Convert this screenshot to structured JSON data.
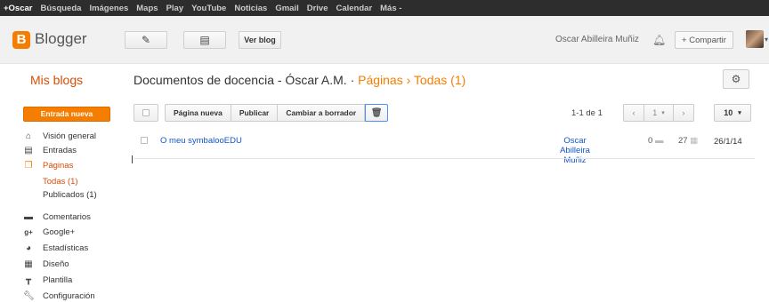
{
  "gbar": {
    "items": [
      "+Oscar",
      "Búsqueda",
      "Imágenes",
      "Maps",
      "Play",
      "YouTube",
      "Noticias",
      "Gmail",
      "Drive",
      "Calendar",
      "Más -"
    ]
  },
  "header": {
    "logo_letter": "B",
    "brand": "Blogger",
    "view_blog": "Ver blog",
    "user_name": "Oscar Abilleira Muñiz",
    "share": "+ Compartir",
    "icons": {
      "edit": "pencil-icon",
      "pages": "pages-icon",
      "notifications": "bell-icon"
    }
  },
  "title_row": {
    "my_blogs": "Mis blogs",
    "blog_title": "Documentos de docencia - Óscar A.M.",
    "separator": "·",
    "crumb_pages": "Páginas",
    "crumb_arrow": "›",
    "crumb_all": "Todas (1)"
  },
  "sidebar": {
    "new_entry": "Entrada nueva",
    "items": [
      {
        "label": "Visión general",
        "icon": "home-icon"
      },
      {
        "label": "Entradas",
        "icon": "posts-icon"
      },
      {
        "label": "Páginas",
        "icon": "pages-icon"
      },
      {
        "label": "Comentarios",
        "icon": "comment-icon"
      },
      {
        "label": "Google+",
        "icon": "google-plus-icon"
      },
      {
        "label": "Estadísticas",
        "icon": "pie-chart-icon"
      },
      {
        "label": "Diseño",
        "icon": "layout-icon"
      },
      {
        "label": "Plantilla",
        "icon": "template-icon"
      },
      {
        "label": "Configuración",
        "icon": "wrench-icon"
      }
    ],
    "sub_items": [
      "Todas (1)",
      "Publicados (1)"
    ]
  },
  "toolbar": {
    "new_page": "Página nueva",
    "publish": "Publicar",
    "to_draft": "Cambiar a borrador",
    "count": "1-1 de 1",
    "page_number": "1",
    "per_page": "10"
  },
  "rows": [
    {
      "title": "O meu symbalooEDU",
      "author": "Oscar Abilleira Muñiz",
      "comments": "0",
      "views": "27",
      "date": "26/1/14"
    }
  ],
  "colors": {
    "accent": "#f57d00",
    "link": "#1155cc",
    "top_bar": "#2d2d2d"
  }
}
